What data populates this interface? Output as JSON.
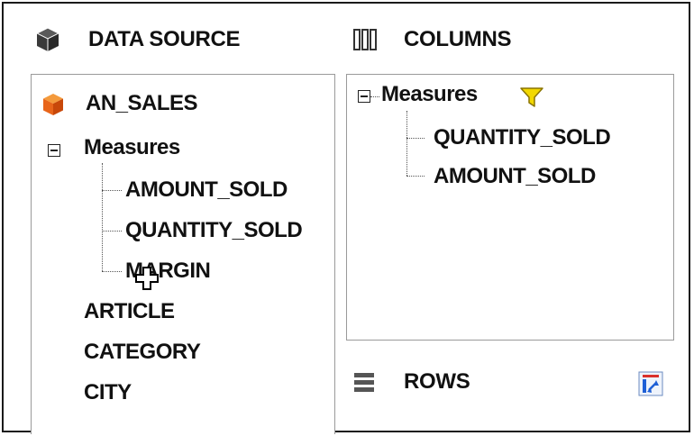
{
  "data_source": {
    "header_label": "DATA SOURCE",
    "icon": "cube-icon",
    "root": {
      "label": "AN_SALES",
      "icon": "orange-cube-icon"
    },
    "measures": {
      "label": "Measures",
      "expanded": true,
      "children": [
        "AMOUNT_SOLD",
        "QUANTITY_SOLD",
        "MARGIN"
      ]
    },
    "dimensions": [
      "ARTICLE",
      "CATEGORY",
      "CITY"
    ]
  },
  "columns": {
    "header_label": "COLUMNS",
    "icon": "columns-icon",
    "measures": {
      "label": "Measures",
      "expanded": true,
      "filter_icon": "filter-icon",
      "children": [
        "QUANTITY_SOLD",
        "AMOUNT_SOLD"
      ]
    }
  },
  "rows": {
    "header_label": "ROWS",
    "icon": "rows-icon",
    "swap_icon": "swap-axes-icon"
  },
  "colors": {
    "cube_orange": "#e8651a",
    "filter_yellow": "#f2d800",
    "swap_blue": "#1e5fd6",
    "swap_red": "#d9302a"
  }
}
